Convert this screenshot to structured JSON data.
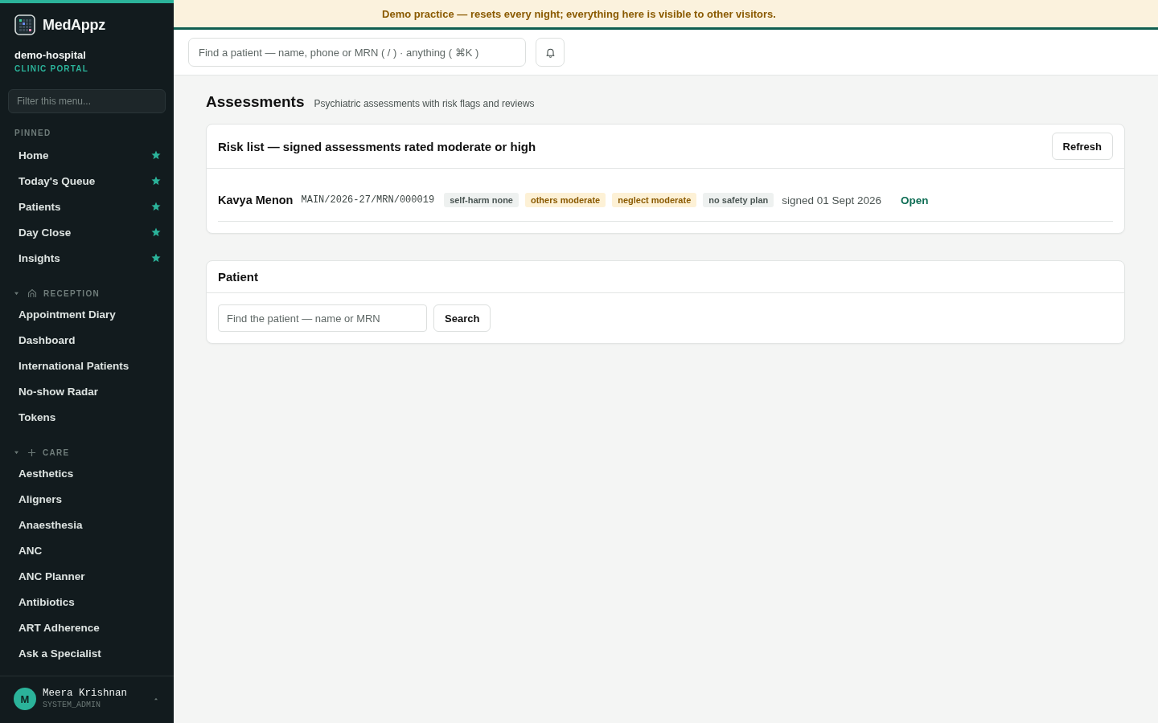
{
  "sidebar": {
    "brand": "MedAppz",
    "org": "demo-hospital",
    "portal": "CLINIC PORTAL",
    "filter": {
      "placeholder": "Filter this menu..."
    },
    "pinned": {
      "label": "PINNED",
      "items": [
        {
          "label": "Home",
          "starred": true
        },
        {
          "label": "Today's Queue",
          "starred": true
        },
        {
          "label": "Patients",
          "starred": true
        },
        {
          "label": "Day Close",
          "starred": true
        },
        {
          "label": "Insights",
          "starred": true
        }
      ]
    },
    "groups": [
      {
        "label": "RECEPTION",
        "expanded": true,
        "items": [
          "Appointment Diary",
          "Dashboard",
          "International Patients",
          "No-show Radar",
          "Tokens"
        ]
      },
      {
        "label": "CARE",
        "expanded": true,
        "items": [
          "Aesthetics",
          "Aligners",
          "Anaesthesia",
          "ANC",
          "ANC Planner",
          "Antibiotics",
          "ART Adherence",
          "Ask a Specialist"
        ]
      }
    ],
    "user": {
      "initial": "M",
      "name": "Meera Krishnan",
      "role": "SYSTEM_ADMIN"
    }
  },
  "banner": {
    "text": "Demo practice — resets every night; everything here is visible to other visitors."
  },
  "topbar": {
    "search": {
      "placeholder": "Find a patient — name, phone or MRN ( / ) · anything ( ⌘K )"
    }
  },
  "page": {
    "title": "Assessments",
    "subtitle": "Psychiatric assessments with risk flags and reviews"
  },
  "risk_card": {
    "title": "Risk list — signed assessments rated moderate or high",
    "refresh": "Refresh",
    "rows": [
      {
        "name": "Kavya Menon",
        "mrn": "MAIN/2026-27/MRN/000019",
        "flags": [
          {
            "text": "self-harm none",
            "warning": false
          },
          {
            "text": "others moderate",
            "warning": true
          },
          {
            "text": "neglect moderate",
            "warning": true
          },
          {
            "text": "no safety plan",
            "warning": false
          }
        ],
        "signed": "signed 01 Sept 2026",
        "action": "Open"
      }
    ]
  },
  "patient_card": {
    "title": "Patient",
    "search": {
      "placeholder": "Find the patient — name or MRN"
    },
    "button": "Search"
  }
}
